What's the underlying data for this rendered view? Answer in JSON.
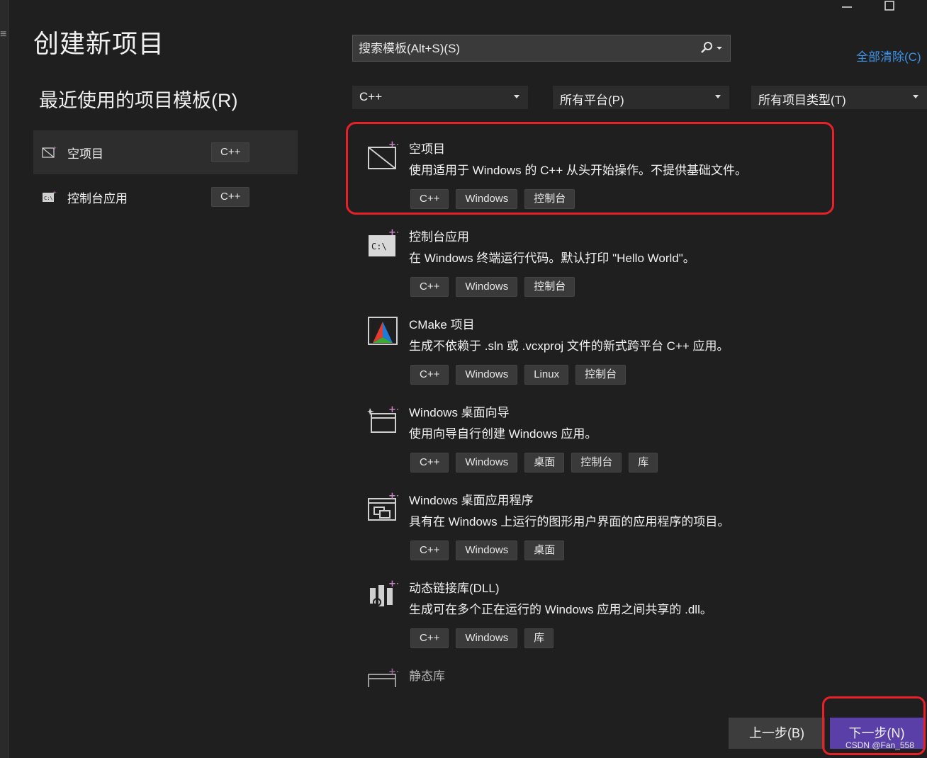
{
  "page_title": "创建新项目",
  "recent": {
    "title": "最近使用的项目模板(R)",
    "items": [
      {
        "label": "空项目",
        "tag": "C++"
      },
      {
        "label": "控制台应用",
        "tag": "C++"
      }
    ]
  },
  "search": {
    "placeholder": "搜索模板(Alt+S)(S)"
  },
  "clear_all": "全部清除(C)",
  "filters": {
    "language": "C++",
    "platform": "所有平台(P)",
    "project_type": "所有项目类型(T)"
  },
  "templates": [
    {
      "name": "空项目",
      "description": "使用适用于 Windows 的 C++ 从头开始操作。不提供基础文件。",
      "tags": [
        "C++",
        "Windows",
        "控制台"
      ]
    },
    {
      "name": "控制台应用",
      "description": "在 Windows 终端运行代码。默认打印 \"Hello World\"。",
      "tags": [
        "C++",
        "Windows",
        "控制台"
      ]
    },
    {
      "name": "CMake 项目",
      "description": "生成不依赖于 .sln 或 .vcxproj 文件的新式跨平台 C++ 应用。",
      "tags": [
        "C++",
        "Windows",
        "Linux",
        "控制台"
      ]
    },
    {
      "name": "Windows 桌面向导",
      "description": "使用向导自行创建 Windows 应用。",
      "tags": [
        "C++",
        "Windows",
        "桌面",
        "控制台",
        "库"
      ]
    },
    {
      "name": "Windows 桌面应用程序",
      "description": "具有在 Windows 上运行的图形用户界面的应用程序的项目。",
      "tags": [
        "C++",
        "Windows",
        "桌面"
      ]
    },
    {
      "name": "动态链接库(DLL)",
      "description": "生成可在多个正在运行的 Windows 应用之间共享的 .dll。",
      "tags": [
        "C++",
        "Windows",
        "库"
      ]
    },
    {
      "name": "静态库",
      "description": "",
      "tags": []
    }
  ],
  "buttons": {
    "back": "上一步(B)",
    "next": "下一步(N)"
  },
  "watermark": "CSDN @Fan_558",
  "colors": {
    "accent_purple": "#5a3fa8",
    "link_blue": "#3c93e8",
    "highlight_red": "#e8202a"
  }
}
